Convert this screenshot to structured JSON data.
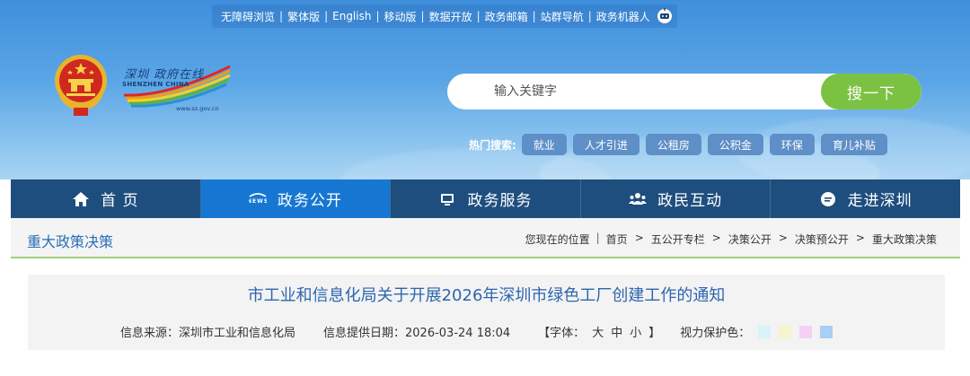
{
  "topbar": {
    "links": [
      "无障碍浏览",
      "繁体版",
      "English",
      "移动版",
      "数据开放",
      "政务邮箱",
      "站群导航",
      "政务机器人"
    ]
  },
  "logo": {
    "cn": "深圳 政府在线",
    "en": "SHENZHEN  CHINA",
    "url": "www.sz.gov.cn"
  },
  "search": {
    "placeholder": "输入关键字",
    "button": "搜一下"
  },
  "hot": {
    "label": "热门搜索:",
    "tags": [
      "就业",
      "人才引进",
      "公租房",
      "公积金",
      "环保",
      "育儿补贴"
    ]
  },
  "nav": [
    {
      "label": "首 页",
      "icon": "home-icon"
    },
    {
      "label": "政务公开",
      "icon": "news-icon"
    },
    {
      "label": "政务服务",
      "icon": "monitor-icon"
    },
    {
      "label": "政民互动",
      "icon": "people-icon"
    },
    {
      "label": "走进深圳",
      "icon": "chat-icon"
    }
  ],
  "nav_active": "政务公开",
  "section_title": "重大政策决策",
  "breadcrumb": {
    "prefix": "您现在的位置",
    "items": [
      "首页",
      "五公开专栏",
      "决策公开",
      "决策预公开",
      "重大政策决策"
    ]
  },
  "article": {
    "title": "市工业和信息化局关于开展2026年深圳市绿色工厂创建工作的通知",
    "source": "信息来源：深圳市工业和信息化局",
    "date": "信息提供日期：2026-03-24 18:04",
    "font_open": "【字体：",
    "font_large": "大",
    "font_medium": "中",
    "font_small": "小",
    "font_close": "】",
    "vision_label": "视力保护色：",
    "vision_colors": [
      "#d8f4f8",
      "#f6f4cc",
      "#f6d0f4",
      "#a8cff4"
    ]
  },
  "colors": {
    "nav_bg": "#1e4e7e",
    "nav_active": "#1677d2",
    "search_button": "#7cc242",
    "title_blue": "#2d66b0"
  }
}
